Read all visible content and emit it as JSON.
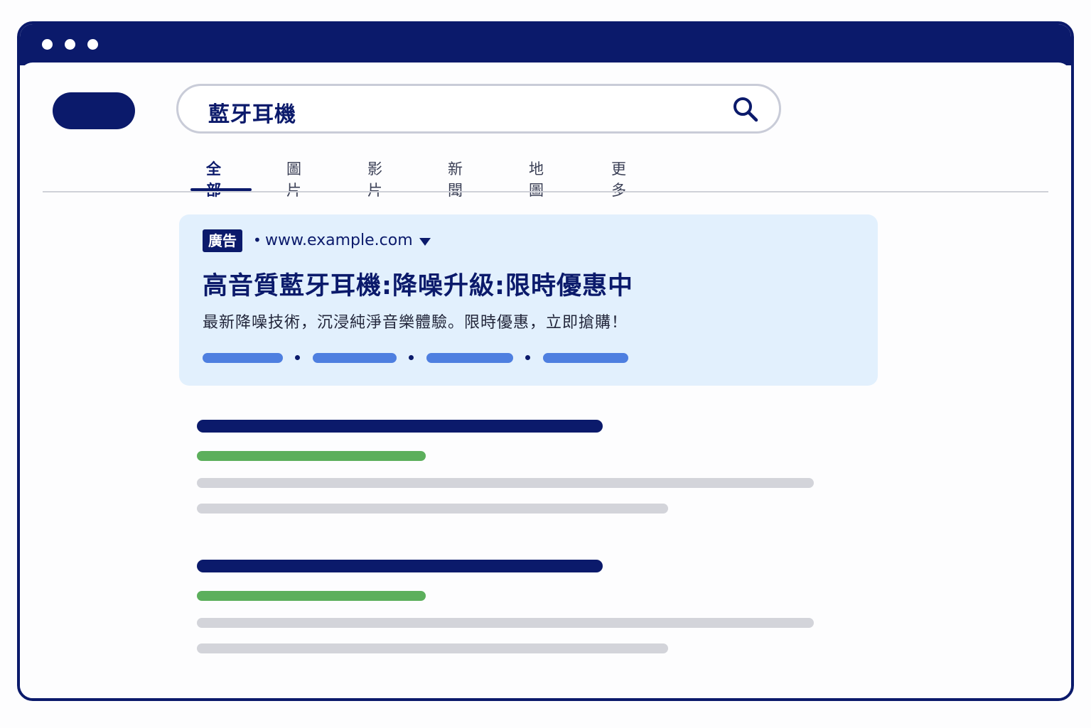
{
  "search": {
    "query": "藍牙耳機"
  },
  "tabs": [
    {
      "label": "全部",
      "active": true
    },
    {
      "label": "圖片"
    },
    {
      "label": "影片"
    },
    {
      "label": "新聞"
    },
    {
      "label": "地圖"
    },
    {
      "label": "更多"
    }
  ],
  "ad": {
    "badge": "廣告",
    "separator": "•",
    "url": "www.example.com",
    "title": "高音質藍牙耳機:降噪升級:限時優惠中",
    "description": "最新降噪技術，沉浸純淨音樂體驗。限時優惠，立即搶購！"
  },
  "colors": {
    "brand": "#0b1a6b",
    "ad_background": "#e2f0fd",
    "ad_links": "#4e7fe0",
    "result_url": "#5caf5c",
    "placeholder_text": "#d3d4da"
  },
  "icons": {
    "search": "search-icon",
    "dropdown": "caret-down-icon"
  }
}
